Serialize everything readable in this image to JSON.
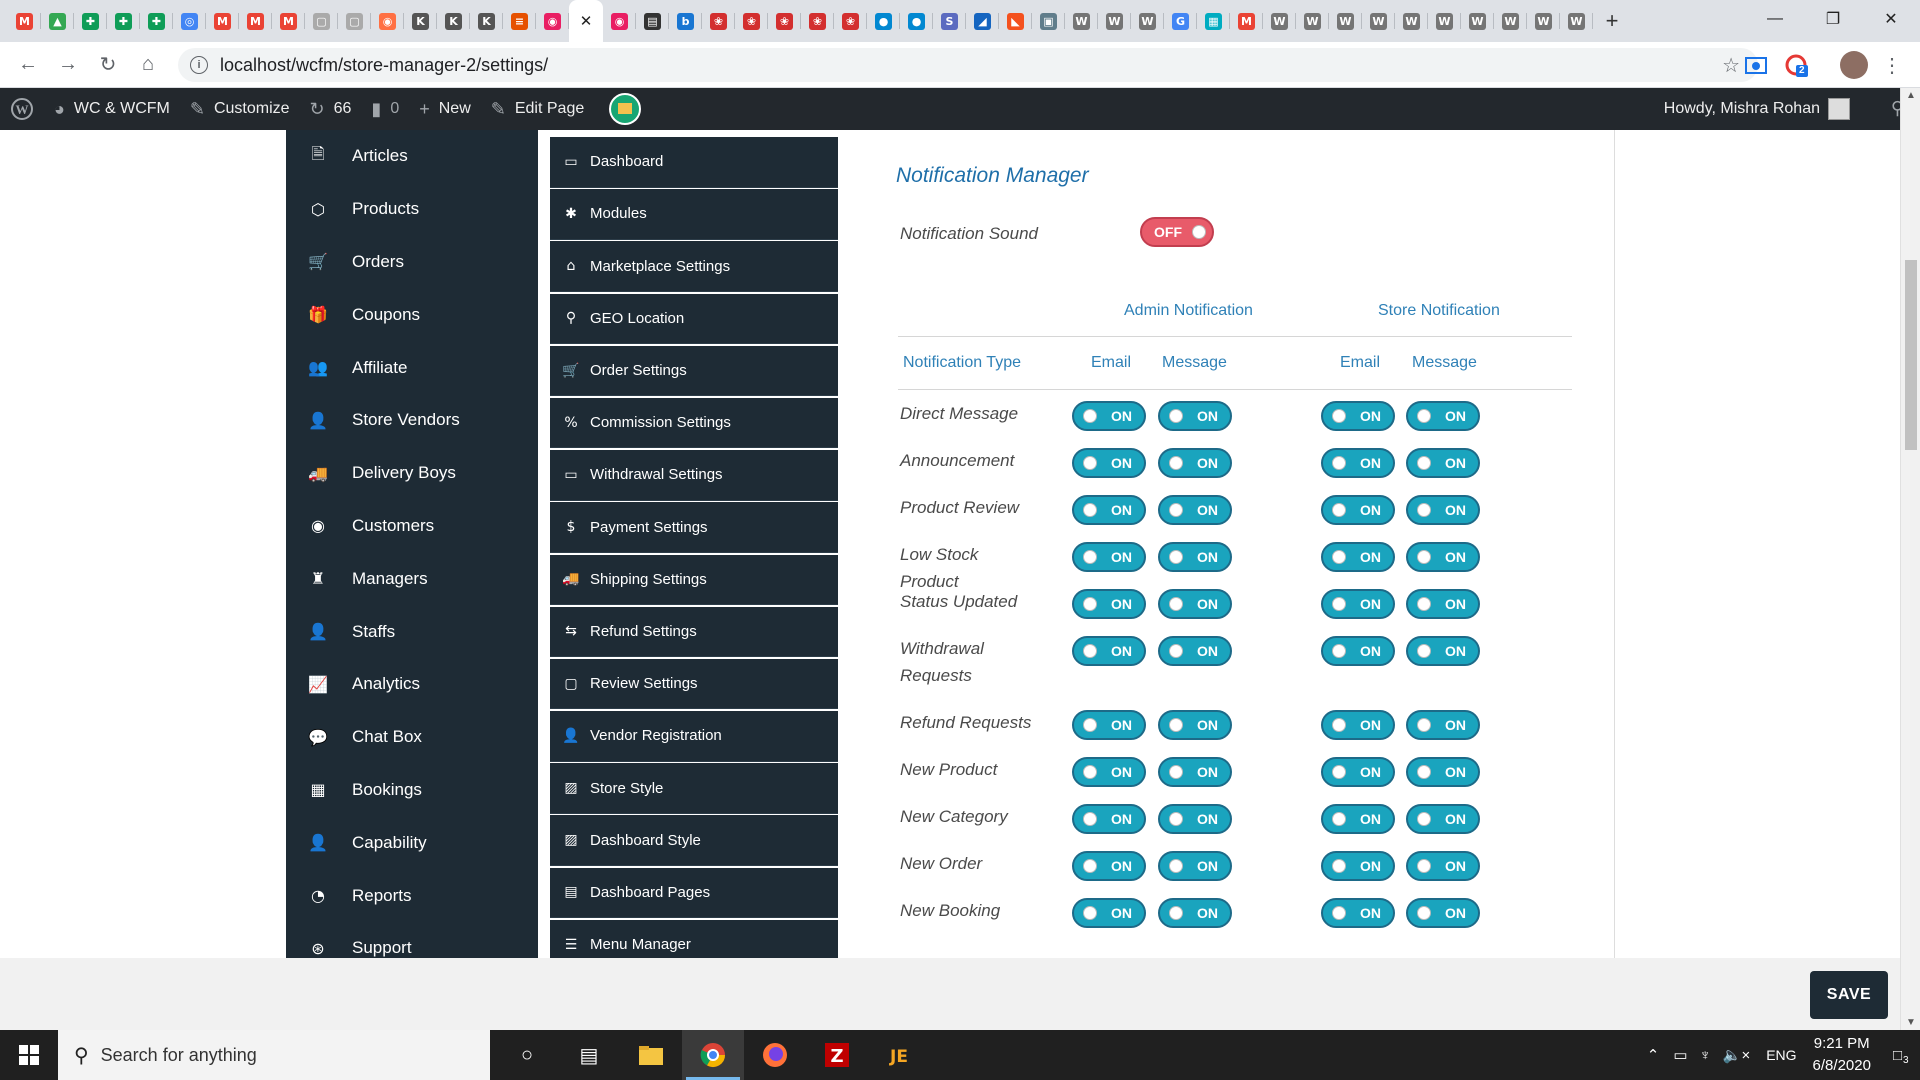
{
  "browser": {
    "tabs_count": 48,
    "url": "localhost/wcfm/store-manager-2/settings/",
    "extension_badge": "2"
  },
  "wpbar": {
    "site": "WC & WCFM",
    "customize": "Customize",
    "updates": "66",
    "comments": "0",
    "new": "New",
    "edit_page": "Edit Page",
    "howdy": "Howdy, Mishra Rohan"
  },
  "leftnav": [
    {
      "label": "Articles",
      "icon": "article-icon"
    },
    {
      "label": "Products",
      "icon": "cube-icon"
    },
    {
      "label": "Orders",
      "icon": "cart-icon"
    },
    {
      "label": "Coupons",
      "icon": "gift-icon"
    },
    {
      "label": "Affiliate",
      "icon": "users-icon"
    },
    {
      "label": "Store Vendors",
      "icon": "user-icon"
    },
    {
      "label": "Delivery Boys",
      "icon": "truck-icon"
    },
    {
      "label": "Customers",
      "icon": "user-circle-icon"
    },
    {
      "label": "Managers",
      "icon": "manager-icon"
    },
    {
      "label": "Staffs",
      "icon": "user-icon"
    },
    {
      "label": "Analytics",
      "icon": "chart-line-icon"
    },
    {
      "label": "Chat Box",
      "icon": "chat-icon"
    },
    {
      "label": "Bookings",
      "icon": "calendar-icon"
    },
    {
      "label": "Capability",
      "icon": "user-x-icon"
    },
    {
      "label": "Reports",
      "icon": "pie-chart-icon"
    },
    {
      "label": "Support",
      "icon": "lifebuoy-icon"
    }
  ],
  "settings_nav": [
    {
      "label": "Dashboard",
      "icon": "monitor-icon"
    },
    {
      "label": "Modules",
      "icon": "modules-icon"
    },
    {
      "label": "Marketplace Settings",
      "icon": "home-icon"
    },
    {
      "label": "GEO Location",
      "icon": "location-icon"
    },
    {
      "label": "Order Settings",
      "icon": "cart-icon"
    },
    {
      "label": "Commission Settings",
      "icon": "percent-icon"
    },
    {
      "label": "Withdrawal Settings",
      "icon": "card-icon"
    },
    {
      "label": "Payment Settings",
      "icon": "dollar-icon"
    },
    {
      "label": "Shipping Settings",
      "icon": "truck-icon"
    },
    {
      "label": "Refund Settings",
      "icon": "refund-icon"
    },
    {
      "label": "Review Settings",
      "icon": "comment-icon"
    },
    {
      "label": "Vendor Registration",
      "icon": "user-icon"
    },
    {
      "label": "Store Style",
      "icon": "image-icon"
    },
    {
      "label": "Dashboard Style",
      "icon": "image-icon"
    },
    {
      "label": "Dashboard Pages",
      "icon": "pages-icon"
    },
    {
      "label": "Menu Manager",
      "icon": "menu-icon"
    }
  ],
  "panel": {
    "title": "Notification Manager",
    "sound_label": "Notification Sound",
    "sound_state": "OFF",
    "headers": {
      "admin": "Admin Notification",
      "store": "Store Notification",
      "type": "Notification Type",
      "email": "Email",
      "message": "Message"
    },
    "rows": [
      {
        "label": "Direct Message",
        "states": [
          "ON",
          "ON",
          "ON",
          "ON"
        ]
      },
      {
        "label": "Announcement",
        "states": [
          "ON",
          "ON",
          "ON",
          "ON"
        ]
      },
      {
        "label": "Product Review",
        "states": [
          "ON",
          "ON",
          "ON",
          "ON"
        ]
      },
      {
        "label": "Low Stock Product",
        "states": [
          "ON",
          "ON",
          "ON",
          "ON"
        ]
      },
      {
        "label": "Status Updated",
        "states": [
          "ON",
          "ON",
          "ON",
          "ON"
        ]
      },
      {
        "label": "Withdrawal Requests",
        "states": [
          "ON",
          "ON",
          "ON",
          "ON"
        ]
      },
      {
        "label": "Refund Requests",
        "states": [
          "ON",
          "ON",
          "ON",
          "ON"
        ]
      },
      {
        "label": "New Product",
        "states": [
          "ON",
          "ON",
          "ON",
          "ON"
        ]
      },
      {
        "label": "New Category",
        "states": [
          "ON",
          "ON",
          "ON",
          "ON"
        ]
      },
      {
        "label": "New Order",
        "states": [
          "ON",
          "ON",
          "ON",
          "ON"
        ]
      },
      {
        "label": "New Booking",
        "states": [
          "ON",
          "ON",
          "ON",
          "ON"
        ]
      }
    ]
  },
  "save_label": "SAVE",
  "taskbar": {
    "search_placeholder": "Search for anything",
    "lang": "ENG",
    "time": "9:21 PM",
    "date": "6/8/2020",
    "notifications": "3"
  },
  "colors": {
    "sidebar": "#1e2b35",
    "toggle_on": "#1aa4be",
    "toggle_off": "#e85b6a",
    "heading": "#1f6fa9"
  }
}
